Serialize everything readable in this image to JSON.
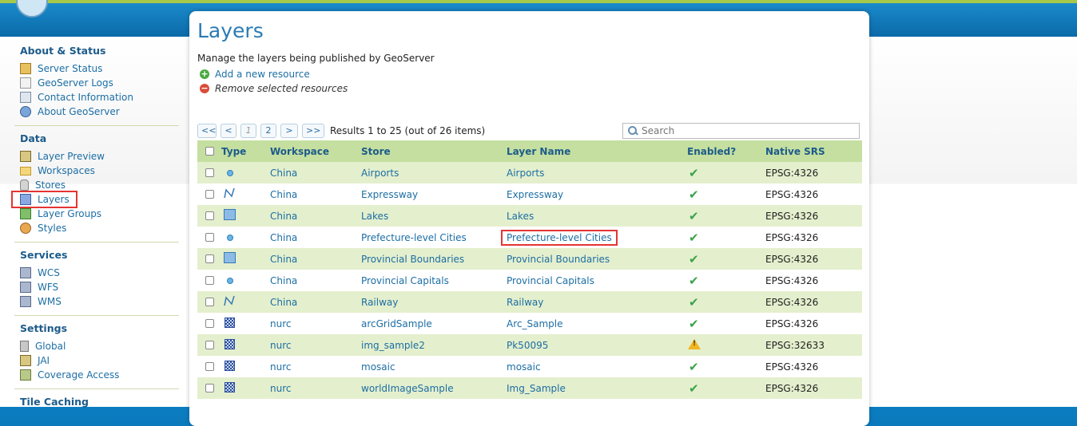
{
  "sidebar": {
    "sections": [
      {
        "title": "About & Status",
        "items": [
          {
            "label": "Server Status",
            "icon": "server-status-icon"
          },
          {
            "label": "GeoServer Logs",
            "icon": "logs-icon"
          },
          {
            "label": "Contact Information",
            "icon": "contact-icon"
          },
          {
            "label": "About GeoServer",
            "icon": "about-icon"
          }
        ]
      },
      {
        "title": "Data",
        "items": [
          {
            "label": "Layer Preview",
            "icon": "layer-preview-icon"
          },
          {
            "label": "Workspaces",
            "icon": "folder-icon"
          },
          {
            "label": "Stores",
            "icon": "database-icon"
          },
          {
            "label": "Layers",
            "icon": "layers-icon"
          },
          {
            "label": "Layer Groups",
            "icon": "layer-groups-icon"
          },
          {
            "label": "Styles",
            "icon": "palette-icon"
          }
        ]
      },
      {
        "title": "Services",
        "items": [
          {
            "label": "WCS",
            "icon": "wcs-icon"
          },
          {
            "label": "WFS",
            "icon": "wfs-icon"
          },
          {
            "label": "WMS",
            "icon": "wms-icon"
          }
        ]
      },
      {
        "title": "Settings",
        "items": [
          {
            "label": "Global",
            "icon": "global-icon"
          },
          {
            "label": "JAI",
            "icon": "jai-icon"
          },
          {
            "label": "Coverage Access",
            "icon": "coverage-icon"
          }
        ]
      },
      {
        "title": "Tile Caching",
        "items": []
      }
    ],
    "selected": "Layers"
  },
  "main": {
    "title": "Layers",
    "description": "Manage the layers being published by GeoServer",
    "add_label": "Add a new resource",
    "remove_label": "Remove selected resources",
    "pager": {
      "first": "<<",
      "prev": "<",
      "page1": "1",
      "page2": "2",
      "next": ">",
      "last": ">>"
    },
    "results": "Results 1 to 25 (out of 26 items)",
    "search_placeholder": "Search",
    "columns": [
      "Type",
      "Workspace",
      "Store",
      "Layer Name",
      "Enabled?",
      "Native SRS"
    ],
    "rows": [
      {
        "type": "point",
        "workspace": "China",
        "store": "Airports",
        "layer": "Airports",
        "enabled": "check",
        "srs": "EPSG:4326"
      },
      {
        "type": "line",
        "workspace": "China",
        "store": "Expressway",
        "layer": "Expressway",
        "enabled": "check",
        "srs": "EPSG:4326"
      },
      {
        "type": "polygon",
        "workspace": "China",
        "store": "Lakes",
        "layer": "Lakes",
        "enabled": "check",
        "srs": "EPSG:4326"
      },
      {
        "type": "point",
        "workspace": "China",
        "store": "Prefecture-level Cities",
        "layer": "Prefecture-level Cities",
        "enabled": "check",
        "srs": "EPSG:4326"
      },
      {
        "type": "polygon",
        "workspace": "China",
        "store": "Provincial Boundaries",
        "layer": "Provincial Boundaries",
        "enabled": "check",
        "srs": "EPSG:4326"
      },
      {
        "type": "point",
        "workspace": "China",
        "store": "Provincial Capitals",
        "layer": "Provincial Capitals",
        "enabled": "check",
        "srs": "EPSG:4326"
      },
      {
        "type": "line",
        "workspace": "China",
        "store": "Railway",
        "layer": "Railway",
        "enabled": "check",
        "srs": "EPSG:4326"
      },
      {
        "type": "raster",
        "workspace": "nurc",
        "store": "arcGridSample",
        "layer": "Arc_Sample",
        "enabled": "check",
        "srs": "EPSG:4326"
      },
      {
        "type": "raster",
        "workspace": "nurc",
        "store": "img_sample2",
        "layer": "Pk50095",
        "enabled": "warning",
        "srs": "EPSG:32633"
      },
      {
        "type": "raster",
        "workspace": "nurc",
        "store": "mosaic",
        "layer": "mosaic",
        "enabled": "check",
        "srs": "EPSG:4326"
      },
      {
        "type": "raster",
        "workspace": "nurc",
        "store": "worldImageSample",
        "layer": "Img_Sample",
        "enabled": "check",
        "srs": "EPSG:4326"
      }
    ],
    "highlighted_layer": "Prefecture-level Cities"
  },
  "colors": {
    "accent": "#2a7bb4",
    "header_row": "#c5dfa0",
    "odd_row": "#e4efcd",
    "highlight": "#e53434"
  }
}
